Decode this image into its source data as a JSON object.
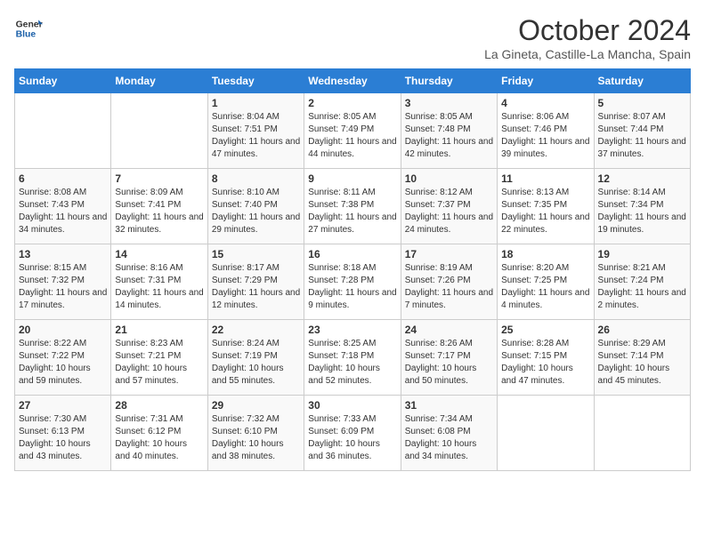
{
  "header": {
    "logo_line1": "General",
    "logo_line2": "Blue",
    "month": "October 2024",
    "location": "La Gineta, Castille-La Mancha, Spain"
  },
  "weekdays": [
    "Sunday",
    "Monday",
    "Tuesday",
    "Wednesday",
    "Thursday",
    "Friday",
    "Saturday"
  ],
  "weeks": [
    [
      {
        "day": "",
        "info": ""
      },
      {
        "day": "",
        "info": ""
      },
      {
        "day": "1",
        "info": "Sunrise: 8:04 AM\nSunset: 7:51 PM\nDaylight: 11 hours and 47 minutes."
      },
      {
        "day": "2",
        "info": "Sunrise: 8:05 AM\nSunset: 7:49 PM\nDaylight: 11 hours and 44 minutes."
      },
      {
        "day": "3",
        "info": "Sunrise: 8:05 AM\nSunset: 7:48 PM\nDaylight: 11 hours and 42 minutes."
      },
      {
        "day": "4",
        "info": "Sunrise: 8:06 AM\nSunset: 7:46 PM\nDaylight: 11 hours and 39 minutes."
      },
      {
        "day": "5",
        "info": "Sunrise: 8:07 AM\nSunset: 7:44 PM\nDaylight: 11 hours and 37 minutes."
      }
    ],
    [
      {
        "day": "6",
        "info": "Sunrise: 8:08 AM\nSunset: 7:43 PM\nDaylight: 11 hours and 34 minutes."
      },
      {
        "day": "7",
        "info": "Sunrise: 8:09 AM\nSunset: 7:41 PM\nDaylight: 11 hours and 32 minutes."
      },
      {
        "day": "8",
        "info": "Sunrise: 8:10 AM\nSunset: 7:40 PM\nDaylight: 11 hours and 29 minutes."
      },
      {
        "day": "9",
        "info": "Sunrise: 8:11 AM\nSunset: 7:38 PM\nDaylight: 11 hours and 27 minutes."
      },
      {
        "day": "10",
        "info": "Sunrise: 8:12 AM\nSunset: 7:37 PM\nDaylight: 11 hours and 24 minutes."
      },
      {
        "day": "11",
        "info": "Sunrise: 8:13 AM\nSunset: 7:35 PM\nDaylight: 11 hours and 22 minutes."
      },
      {
        "day": "12",
        "info": "Sunrise: 8:14 AM\nSunset: 7:34 PM\nDaylight: 11 hours and 19 minutes."
      }
    ],
    [
      {
        "day": "13",
        "info": "Sunrise: 8:15 AM\nSunset: 7:32 PM\nDaylight: 11 hours and 17 minutes."
      },
      {
        "day": "14",
        "info": "Sunrise: 8:16 AM\nSunset: 7:31 PM\nDaylight: 11 hours and 14 minutes."
      },
      {
        "day": "15",
        "info": "Sunrise: 8:17 AM\nSunset: 7:29 PM\nDaylight: 11 hours and 12 minutes."
      },
      {
        "day": "16",
        "info": "Sunrise: 8:18 AM\nSunset: 7:28 PM\nDaylight: 11 hours and 9 minutes."
      },
      {
        "day": "17",
        "info": "Sunrise: 8:19 AM\nSunset: 7:26 PM\nDaylight: 11 hours and 7 minutes."
      },
      {
        "day": "18",
        "info": "Sunrise: 8:20 AM\nSunset: 7:25 PM\nDaylight: 11 hours and 4 minutes."
      },
      {
        "day": "19",
        "info": "Sunrise: 8:21 AM\nSunset: 7:24 PM\nDaylight: 11 hours and 2 minutes."
      }
    ],
    [
      {
        "day": "20",
        "info": "Sunrise: 8:22 AM\nSunset: 7:22 PM\nDaylight: 10 hours and 59 minutes."
      },
      {
        "day": "21",
        "info": "Sunrise: 8:23 AM\nSunset: 7:21 PM\nDaylight: 10 hours and 57 minutes."
      },
      {
        "day": "22",
        "info": "Sunrise: 8:24 AM\nSunset: 7:19 PM\nDaylight: 10 hours and 55 minutes."
      },
      {
        "day": "23",
        "info": "Sunrise: 8:25 AM\nSunset: 7:18 PM\nDaylight: 10 hours and 52 minutes."
      },
      {
        "day": "24",
        "info": "Sunrise: 8:26 AM\nSunset: 7:17 PM\nDaylight: 10 hours and 50 minutes."
      },
      {
        "day": "25",
        "info": "Sunrise: 8:28 AM\nSunset: 7:15 PM\nDaylight: 10 hours and 47 minutes."
      },
      {
        "day": "26",
        "info": "Sunrise: 8:29 AM\nSunset: 7:14 PM\nDaylight: 10 hours and 45 minutes."
      }
    ],
    [
      {
        "day": "27",
        "info": "Sunrise: 7:30 AM\nSunset: 6:13 PM\nDaylight: 10 hours and 43 minutes."
      },
      {
        "day": "28",
        "info": "Sunrise: 7:31 AM\nSunset: 6:12 PM\nDaylight: 10 hours and 40 minutes."
      },
      {
        "day": "29",
        "info": "Sunrise: 7:32 AM\nSunset: 6:10 PM\nDaylight: 10 hours and 38 minutes."
      },
      {
        "day": "30",
        "info": "Sunrise: 7:33 AM\nSunset: 6:09 PM\nDaylight: 10 hours and 36 minutes."
      },
      {
        "day": "31",
        "info": "Sunrise: 7:34 AM\nSunset: 6:08 PM\nDaylight: 10 hours and 34 minutes."
      },
      {
        "day": "",
        "info": ""
      },
      {
        "day": "",
        "info": ""
      }
    ]
  ]
}
